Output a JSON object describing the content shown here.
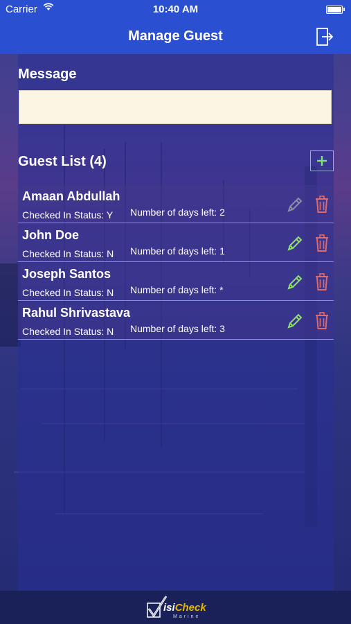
{
  "status_bar": {
    "carrier": "Carrier",
    "time": "10:40 AM"
  },
  "nav": {
    "title": "Manage Guest",
    "logout_icon": "logout-icon"
  },
  "message": {
    "label": "Message",
    "value": "",
    "placeholder": ""
  },
  "guest_list": {
    "label": "Guest List (4)",
    "add_icon": "plus-icon",
    "guests": [
      {
        "name": "Amaan Abdullah",
        "status": "Checked In Status: Y",
        "days": "Number of days left: 2",
        "edit_enabled": false
      },
      {
        "name": "John Doe",
        "status": "Checked In Status: N",
        "days": "Number of days left: 1",
        "edit_enabled": true
      },
      {
        "name": "Joseph Santos",
        "status": "Checked In Status: N",
        "days": "Number of days left: *",
        "edit_enabled": true
      },
      {
        "name": "Rahul Shrivastava",
        "status": "Checked In Status: N",
        "days": "Number of days left: 3",
        "edit_enabled": true
      }
    ]
  },
  "footer": {
    "brand_left": "isi",
    "brand_right": "Check",
    "brand_sub": "Marine"
  },
  "colors": {
    "bar": "#2a4fd0",
    "message_bg": "#fcf5e3",
    "edit_active": "#8fe06a",
    "edit_disabled": "#8a8fa8",
    "delete": "#e06a6a",
    "add": "#7fe07f"
  }
}
